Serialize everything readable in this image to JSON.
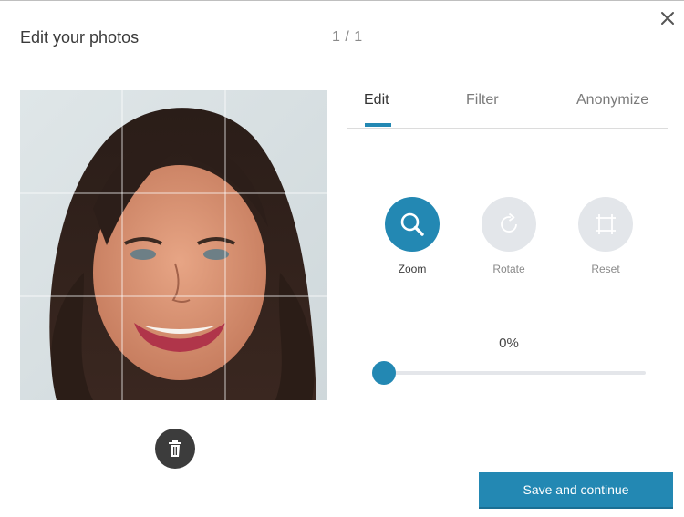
{
  "header": {
    "title": "Edit your photos",
    "counter": "1 / 1",
    "close_icon": "close-icon"
  },
  "photo": {
    "alt": "Portrait of a smiling woman with long dark hair",
    "delete_icon": "trash-icon"
  },
  "tabs": [
    {
      "label": "Edit",
      "active": true
    },
    {
      "label": "Filter",
      "active": false
    },
    {
      "label": "Anonymize",
      "active": false
    }
  ],
  "tools": [
    {
      "label": "Zoom",
      "icon": "magnifier-icon",
      "active": true
    },
    {
      "label": "Rotate",
      "icon": "rotate-icon",
      "active": false
    },
    {
      "label": "Reset",
      "icon": "crop-frame-icon",
      "active": false
    }
  ],
  "zoom": {
    "value_text": "0%",
    "value": 0
  },
  "footer": {
    "save_label": "Save and continue"
  },
  "colors": {
    "accent": "#2388b3",
    "inactive_tool": "#e3e6ea",
    "trash_bg": "#3c3c3c"
  }
}
